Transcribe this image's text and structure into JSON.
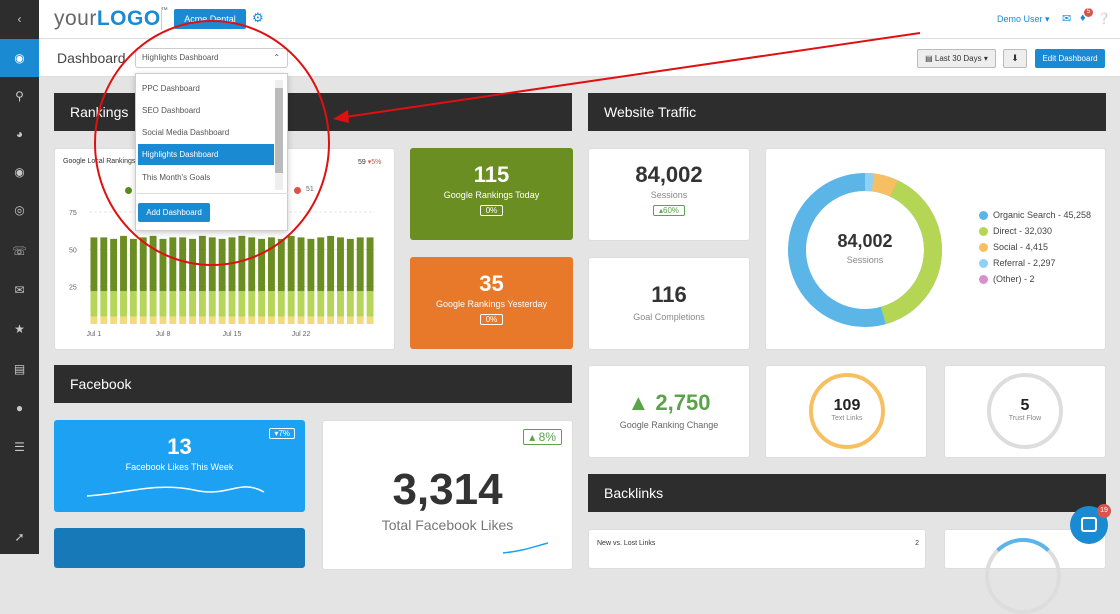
{
  "topbar": {
    "logo_prefix": "your",
    "logo_main": "LOGO",
    "logo_tm": "™",
    "client_button": "Acme Dental",
    "user": "Demo User",
    "notification_count": "5"
  },
  "subbar": {
    "title": "Dashboard",
    "selected_dashboard": "Highlights Dashboard",
    "date_range": "Last 30 Days",
    "edit_button": "Edit Dashboard"
  },
  "dropdown": {
    "items": [
      "PPC Dashboard",
      "SEO Dashboard",
      "Social Media Dashboard",
      "Highlights Dashboard",
      "This Month's Goals"
    ],
    "selected_index": 3,
    "add_button": "Add Dashboard"
  },
  "sections": {
    "rankings": "Rankings",
    "traffic": "Website Traffic",
    "facebook": "Facebook",
    "backlinks": "Backlinks"
  },
  "rankings_chart": {
    "title": "Google Local Rankings",
    "value": "59",
    "change": "5%",
    "legend_right_value": "51"
  },
  "tiles": {
    "rank_today": {
      "value": "115",
      "label": "Google Rankings Today",
      "change": "0%"
    },
    "rank_yesterday": {
      "value": "35",
      "label": "Google Rankings Yesterday",
      "change": "0%"
    },
    "sessions": {
      "value": "84,002",
      "label": "Sessions",
      "change": "60%"
    },
    "goals": {
      "value": "116",
      "label": "Goal Completions"
    },
    "rank_change": {
      "value": "2,750",
      "label": "Google Ranking Change"
    },
    "text_links": {
      "value": "109",
      "label": "Text Links"
    },
    "trust_flow": {
      "value": "5",
      "label": "Trust Flow"
    },
    "fb_week": {
      "value": "13",
      "label": "Facebook Likes This Week",
      "change": "7%"
    },
    "fb_total": {
      "value": "3,314",
      "label": "Total Facebook Likes",
      "change": "8%"
    },
    "new_lost": {
      "label": "New vs. Lost Links",
      "value": "2"
    }
  },
  "donut": {
    "center_value": "84,002",
    "center_label": "Sessions",
    "legend": [
      "Organic Search - 45,258",
      "Direct - 32,030",
      "Social - 4,415",
      "Referral - 2,297",
      "(Other) - 2"
    ],
    "colors": [
      "#5bb5e6",
      "#b5d655",
      "#f6c062",
      "#8fd1f5",
      "#d98fc9"
    ]
  },
  "chat_badge": "19",
  "chart_data": {
    "type": "bar",
    "title": "Google Local Rankings",
    "categories": [
      "Jul 1",
      "",
      "",
      "",
      "",
      "",
      "",
      "Jul 8",
      "",
      "",
      "",
      "",
      "",
      "",
      "Jul 15",
      "",
      "",
      "",
      "",
      "",
      "",
      "Jul 22",
      "",
      "",
      "",
      "",
      "",
      "",
      ""
    ],
    "ylim": [
      0,
      75
    ],
    "yticks": [
      25,
      50,
      75
    ],
    "xticks": [
      "Jul 1",
      "Jul 8",
      "Jul 15",
      "Jul 22"
    ],
    "series": [
      {
        "values": [
          5,
          5,
          5,
          5,
          5,
          5,
          5,
          5,
          5,
          5,
          5,
          5,
          5,
          5,
          5,
          5,
          5,
          5,
          5,
          5,
          5,
          5,
          5,
          5,
          5,
          5,
          5,
          5,
          5
        ]
      },
      {
        "values": [
          17,
          17,
          17,
          17,
          17,
          17,
          17,
          17,
          17,
          17,
          17,
          17,
          17,
          17,
          17,
          17,
          17,
          17,
          17,
          17,
          17,
          17,
          17,
          17,
          17,
          17,
          17,
          17,
          17
        ]
      },
      {
        "values": [
          36,
          36,
          35,
          37,
          35,
          36,
          37,
          35,
          36,
          36,
          35,
          37,
          36,
          35,
          36,
          37,
          36,
          35,
          36,
          35,
          37,
          36,
          35,
          36,
          37,
          36,
          35,
          36,
          36
        ]
      }
    ],
    "colors": [
      "#f3da7e",
      "#b6d65a",
      "#6b8e23"
    ]
  }
}
